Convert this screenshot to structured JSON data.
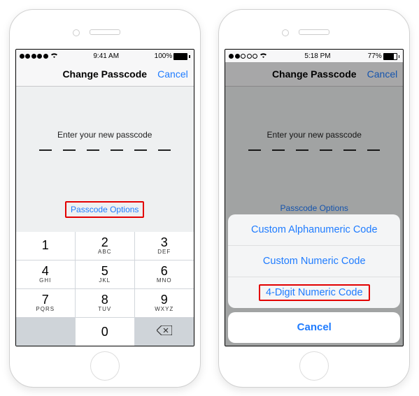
{
  "left": {
    "status": {
      "time": "9:41 AM",
      "battery": "100%",
      "batt_fill_pct": 100,
      "signal_dots": 5
    },
    "nav": {
      "title": "Change Passcode",
      "cancel": "Cancel"
    },
    "prompt": "Enter your new passcode",
    "digit_slots": 6,
    "options": "Passcode Options",
    "keys": [
      {
        "num": "1",
        "letters": ""
      },
      {
        "num": "2",
        "letters": "ABC"
      },
      {
        "num": "3",
        "letters": "DEF"
      },
      {
        "num": "4",
        "letters": "GHI"
      },
      {
        "num": "5",
        "letters": "JKL"
      },
      {
        "num": "6",
        "letters": "MNO"
      },
      {
        "num": "7",
        "letters": "PQRS"
      },
      {
        "num": "8",
        "letters": "TUV"
      },
      {
        "num": "9",
        "letters": "WXYZ"
      }
    ],
    "key_zero": "0"
  },
  "right": {
    "status": {
      "time": "5:18 PM",
      "battery": "77%",
      "batt_fill_pct": 77,
      "signal_dots": 2
    },
    "nav": {
      "title": "Change Passcode",
      "cancel": "Cancel"
    },
    "prompt": "Enter your new passcode",
    "digit_slots": 6,
    "options": "Passcode Options",
    "sheet": {
      "items": [
        "Custom Alphanumeric Code",
        "Custom Numeric Code",
        "4-Digit Numeric Code"
      ],
      "highlighted_index": 2,
      "cancel": "Cancel"
    }
  }
}
